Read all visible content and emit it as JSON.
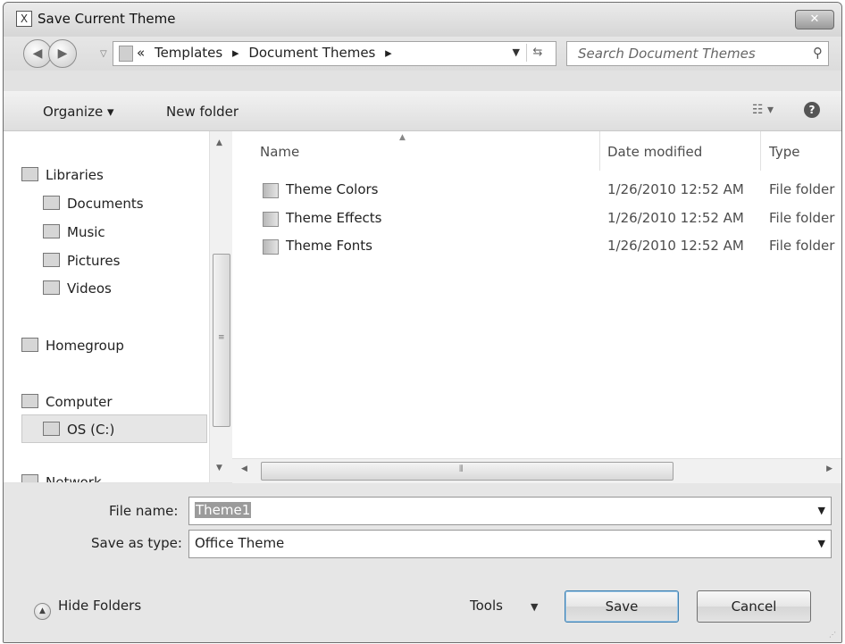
{
  "window": {
    "title": "Save Current Theme",
    "close_glyph": "✕"
  },
  "navbar": {
    "breadcrumbs": [
      "«",
      "Templates",
      "▸",
      "Document Themes",
      "▸"
    ],
    "search_placeholder": "Search Document Themes"
  },
  "toolbar": {
    "organize": "Organize ▾",
    "new_folder": "New folder",
    "view_glyph": "☷ ▾",
    "help_glyph": "?"
  },
  "sidebar": {
    "libraries": "Libraries",
    "items": [
      "Documents",
      "Music",
      "Pictures",
      "Videos"
    ],
    "homegroup": "Homegroup",
    "computer": "Computer",
    "drive": "OS (C:)",
    "network": "Network"
  },
  "files": {
    "columns": [
      "Name",
      "Date modified",
      "Type"
    ],
    "rows": [
      {
        "name": "Theme Colors",
        "date": "1/26/2010 12:52 AM",
        "type": "File folder"
      },
      {
        "name": "Theme Effects",
        "date": "1/26/2010 12:52 AM",
        "type": "File folder"
      },
      {
        "name": "Theme Fonts",
        "date": "1/26/2010 12:52 AM",
        "type": "File folder"
      }
    ]
  },
  "form": {
    "file_name_label": "File name:",
    "file_name_value": "Theme1",
    "save_type_label": "Save as type:",
    "save_type_value": "Office Theme"
  },
  "footer": {
    "hide_folders": "Hide Folders",
    "tools": "Tools",
    "save": "Save",
    "cancel": "Cancel"
  }
}
